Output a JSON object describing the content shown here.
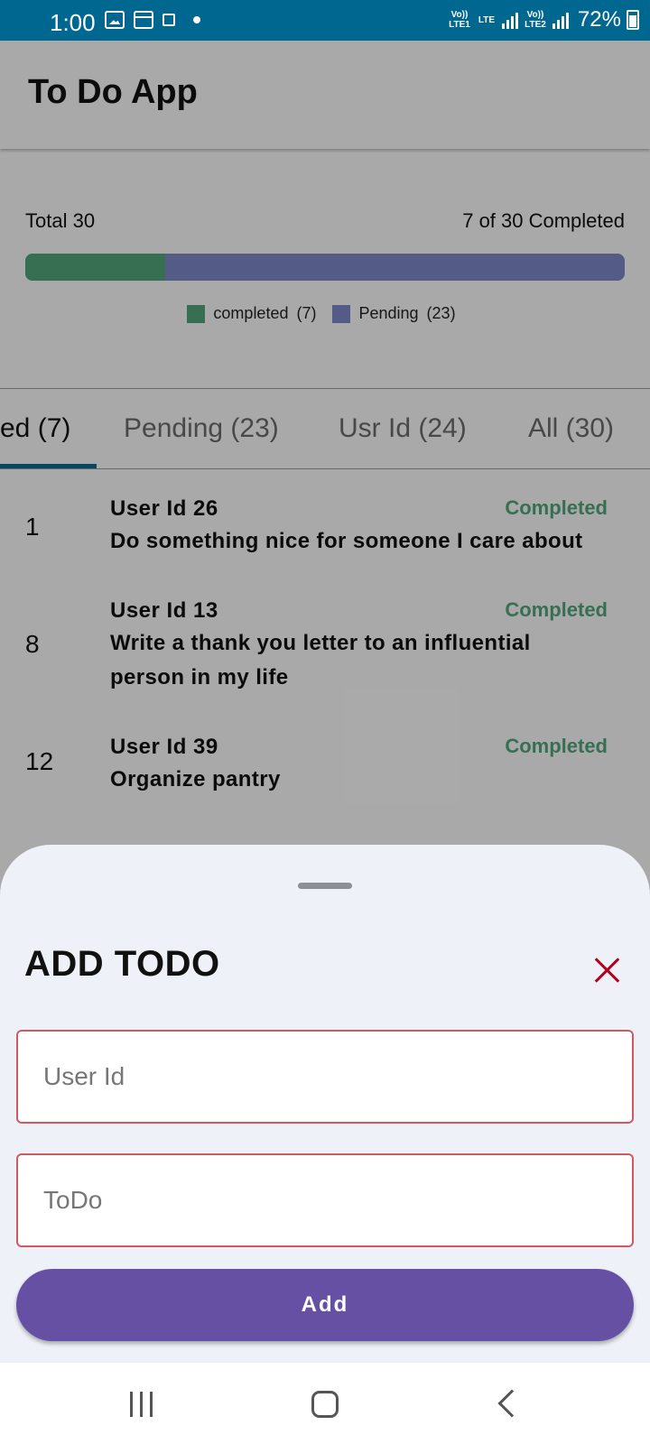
{
  "status_bar": {
    "time": "1:00",
    "net1": "Vo)) LTE1",
    "net_lte": "LTE",
    "net2": "Vo)) LTE2",
    "battery": "72%"
  },
  "app": {
    "title": "To Do App",
    "summary": {
      "total_label": "Total 30",
      "completed_label": "7 of 30 Completed",
      "completed_count": 7,
      "total_count": 30,
      "legend_completed": "completed",
      "legend_completed_count": "(7)",
      "legend_pending": "Pending",
      "legend_pending_count": "(23)",
      "colors": {
        "completed": "#52a47a",
        "pending": "#7b86c6"
      }
    },
    "tabs": [
      {
        "label": "ed (7)",
        "active": true
      },
      {
        "label": "Pending (23)",
        "active": false
      },
      {
        "label": "Usr Id (24)",
        "active": false
      },
      {
        "label": "All (30)",
        "active": false
      }
    ],
    "todos": [
      {
        "id": "1",
        "user": "User Id  26",
        "status": "Completed",
        "text": "Do something nice for someone I care about"
      },
      {
        "id": "8",
        "user": "User Id  13",
        "status": "Completed",
        "text": "Write a thank you letter to an influential person in my life"
      },
      {
        "id": "12",
        "user": "User Id  39",
        "status": "Completed",
        "text": "Organize pantry"
      }
    ]
  },
  "sheet": {
    "title": "ADD TODO",
    "user_id_placeholder": "User Id",
    "todo_placeholder": "ToDo",
    "add_label": "Add"
  }
}
